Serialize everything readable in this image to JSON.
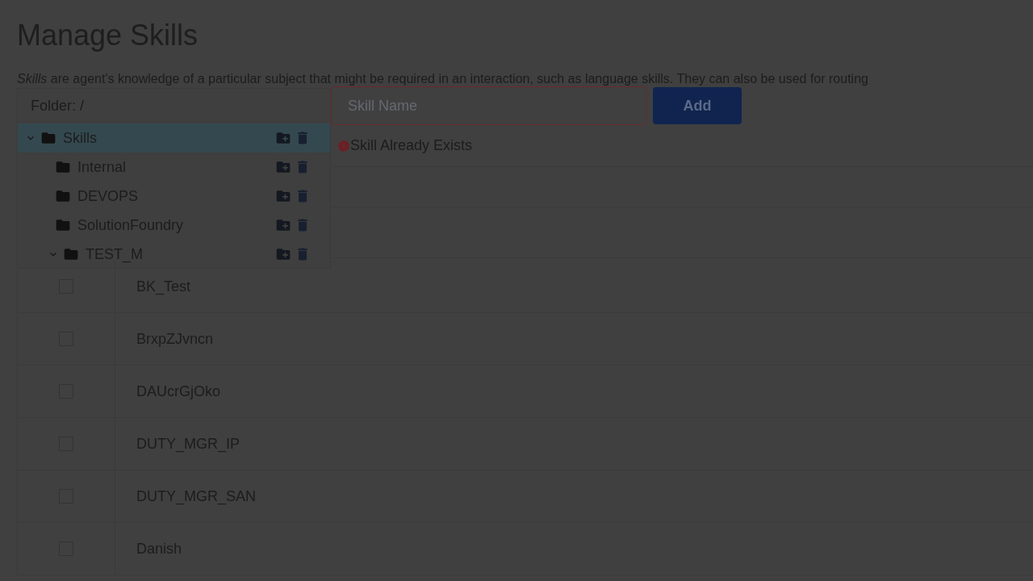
{
  "page": {
    "title": "Manage Skills",
    "description": "*Skills* are agent's knowledge of a particular subject that might be required in an interaction, such as language skills. They can also be used for routing"
  },
  "folder_panel": {
    "path_label": "Folder: /",
    "tree": [
      {
        "label": "Skills",
        "expanded": true,
        "selected": true,
        "children": [
          {
            "label": "Internal",
            "selected": false
          },
          {
            "label": "DEVOPS",
            "selected": false
          },
          {
            "label": "SolutionFoundry",
            "selected": false
          },
          {
            "label": "TEST_M",
            "expanded": true,
            "selected": false
          }
        ]
      }
    ]
  },
  "add_form": {
    "placeholder": "Skill Name",
    "button": "Add",
    "error": "Skill Already Exists"
  },
  "skills": [
    {
      "name": "BK_Test",
      "checked": false
    },
    {
      "name": "BrxpZJvncn",
      "checked": false
    },
    {
      "name": "DAUcrGjOko",
      "checked": false
    },
    {
      "name": "DUTY_MGR_IP",
      "checked": false
    },
    {
      "name": "DUTY_MGR_SAN",
      "checked": false
    },
    {
      "name": "Danish",
      "checked": false
    }
  ]
}
